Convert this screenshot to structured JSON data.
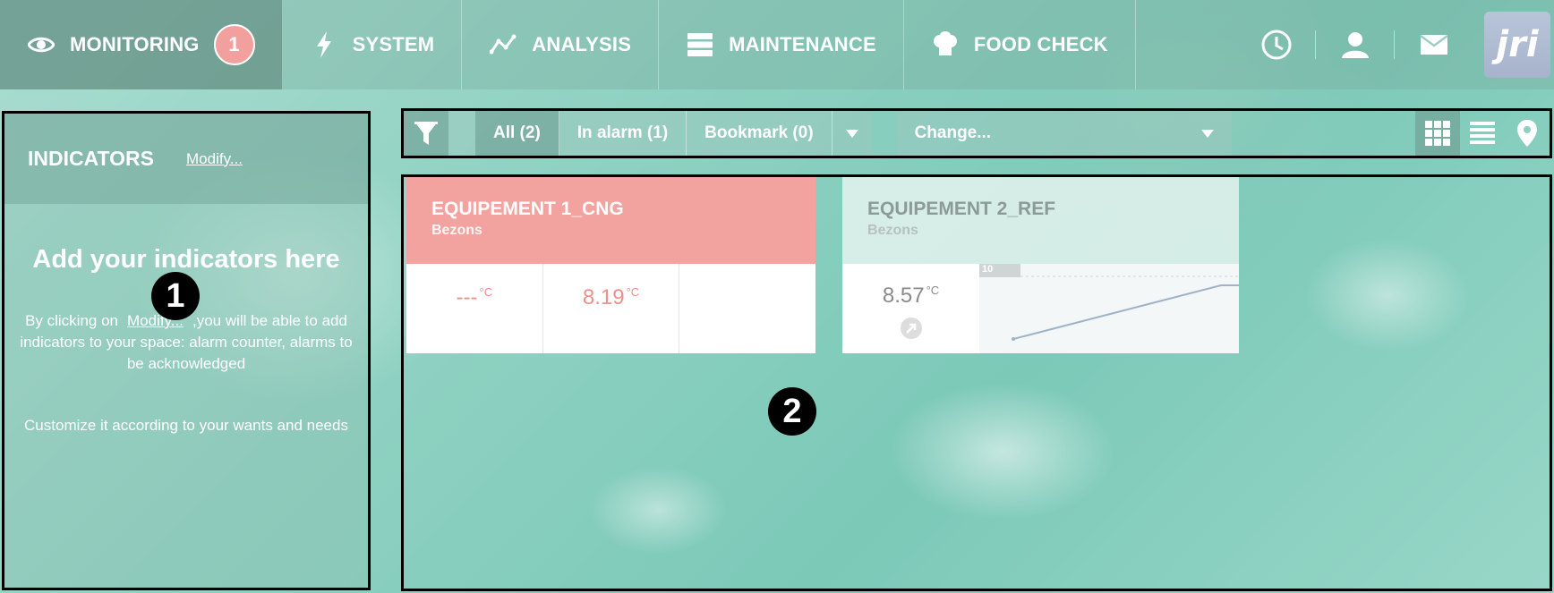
{
  "nav": {
    "items": [
      {
        "id": "monitoring",
        "label": "MONITORING",
        "icon": "eye-icon",
        "badge": "1",
        "active": true
      },
      {
        "id": "system",
        "label": "SYSTEM",
        "icon": "lightning-icon"
      },
      {
        "id": "analysis",
        "label": "ANALYSIS",
        "icon": "trend-line-icon"
      },
      {
        "id": "maintenance",
        "label": "MAINTENANCE",
        "icon": "server-icon"
      },
      {
        "id": "foodcheck",
        "label": "FOOD CHECK",
        "icon": "chef-hat-icon"
      }
    ],
    "utilities": [
      "clock-icon",
      "user-icon",
      "mail-icon"
    ],
    "logo_text": "jri"
  },
  "indicators": {
    "title": "INDICATORS",
    "modify_link": "Modify...",
    "heading": "Add your indicators here",
    "desc_before": "By clicking on",
    "desc_link": "Modify...",
    "desc_after": ",you will be able to add indicators to your space: alarm counter, alarms to be acknowledged",
    "desc2": "Customize it according to your wants and needs"
  },
  "markers": {
    "one": "1",
    "two": "2"
  },
  "toolbar": {
    "tabs": [
      {
        "label": "All (2)",
        "active": true
      },
      {
        "label": "In alarm (1)"
      },
      {
        "label": "Bookmark (0)"
      }
    ],
    "select_label": "Change...",
    "views": [
      "grid-view-icon",
      "list-view-icon",
      "map-pin-icon"
    ]
  },
  "equipments": [
    {
      "name": "EQUIPEMENT 1_CNG",
      "site": "Bezons",
      "values": [
        "---",
        "8.19",
        ""
      ],
      "unit": "°C",
      "status_color": "#f2a3a0"
    },
    {
      "name": "EQUIPEMENT 2_REF",
      "site": "Bezons",
      "value": "8.57",
      "unit": "°C",
      "chart_label": "10"
    }
  ]
}
